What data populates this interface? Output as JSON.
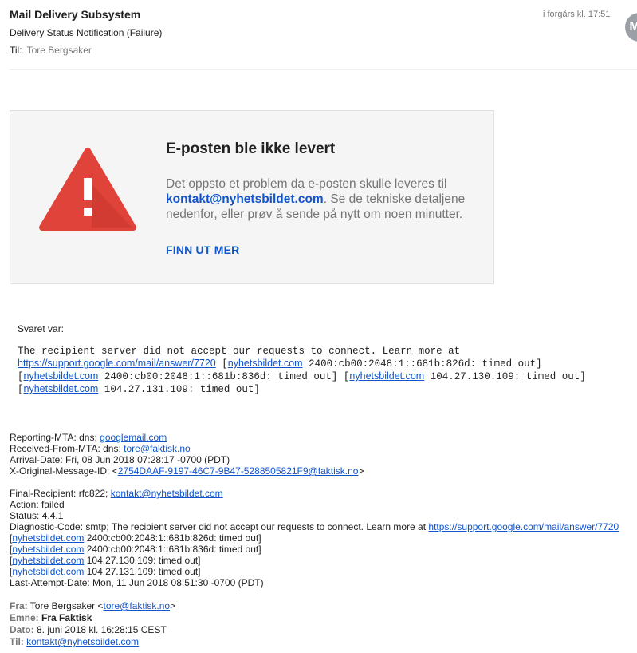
{
  "header": {
    "sender": "Mail Delivery Subsystem",
    "subject": "Delivery Status Notification (Failure)",
    "to_label": "Til:",
    "to_value": "Tore Bergsaker",
    "timestamp": "i forgårs kl. 17:51",
    "avatar_initial": "M"
  },
  "card": {
    "icon": "warning-triangle-icon",
    "icon_color": "#e0433a",
    "title": "E-posten ble ikke levert",
    "body_before": "Det oppsto et problem da e-posten skulle leveres til ",
    "address": "kontakt@nyhetsbildet.com",
    "body_after": ". Se de tekniske detaljene nedenfor, eller prøv å sende på nytt om noen minutter.",
    "link_label": "FINN UT MER"
  },
  "answer": {
    "label": "Svaret var:",
    "line1": "The recipient server did not accept our requests to connect. Learn more at",
    "url": "https://support.google.com/mail/answer/7720",
    "domain": "nyhetsbildet.com",
    "ip1": "2400:cb00:2048:1::681b:826d: timed out]",
    "ip2": "2400:cb00:2048:1::681b:836d: timed out]",
    "ip3": "104.27.130.109: timed out]",
    "ip4": "104.27.131.109: timed out]"
  },
  "dsn1": {
    "reporting_label": "Reporting-MTA: dns; ",
    "reporting_link": "googlemail.com",
    "received_label": "Received-From-MTA: dns; ",
    "received_link": "tore@faktisk.no",
    "arrival": "Arrival-Date: Fri, 08 Jun 2018 07:28:17 -0700 (PDT)",
    "xorig_label": "X-Original-Message-ID: <",
    "xorig_link": "2754DAAF-9197-46C7-9B47-5288505821F9@faktisk.no",
    "xorig_end": ">"
  },
  "dsn2": {
    "final_label": "Final-Recipient: rfc822; ",
    "final_link": "kontakt@nyhetsbildet.com",
    "action": "Action: failed",
    "status": "Status: 4.4.1",
    "diag": "Diagnostic-Code: smtp; The recipient server did not accept our requests to connect. Learn more at ",
    "diag_link": "https://support.google.com/mail/answer/7720",
    "domain": "nyhetsbildet.com",
    "r1": " 2400:cb00:2048:1::681b:826d: timed out]",
    "r2": " 2400:cb00:2048:1::681b:836d: timed out]",
    "r3": " 104.27.130.109: timed out]",
    "r4": " 104.27.131.109: timed out]",
    "last_attempt": "Last-Attempt-Date: Mon, 11 Jun 2018 08:51:30 -0700 (PDT)"
  },
  "forwarded": {
    "from_label": "Fra:",
    "from_name": " Tore Bergsaker <",
    "from_link": "tore@faktisk.no",
    "from_end": ">",
    "subject_label": "Emne:",
    "subject_value": " Fra Faktisk",
    "date_label": "Dato:",
    "date_value": " 8. juni 2018 kl. 16:28:15 CEST",
    "to_label": "Til:",
    "to_link": "kontakt@nyhetsbildet.com"
  }
}
